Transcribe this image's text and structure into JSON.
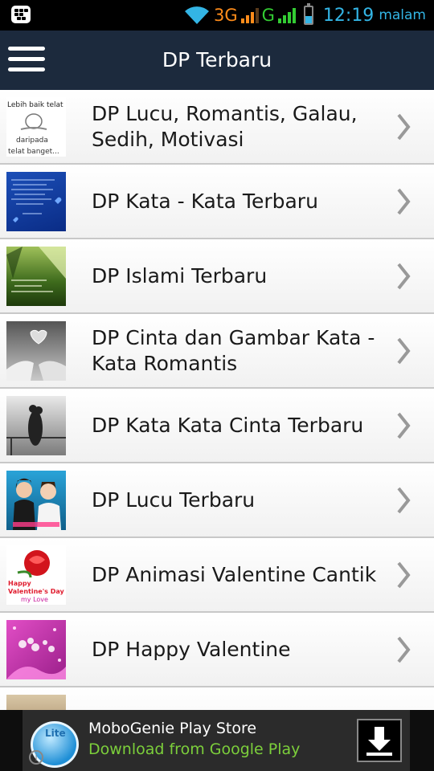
{
  "status_bar": {
    "network_3g": "3G",
    "network_g": "G",
    "time": "12:19",
    "period": "malam",
    "battery_level": 0.45
  },
  "action_bar": {
    "title": "DP Terbaru",
    "menu_icon": "hamburger-menu-icon"
  },
  "list": {
    "chevron_icon": "chevron-right-icon",
    "items": [
      {
        "label": "DP Lucu, Romantis, Galau, Sedih, Motivasi",
        "thumb_text": [
          "Lebih baik telat",
          "daripada",
          "telat banget..."
        ]
      },
      {
        "label": "DP Kata - Kata Terbaru"
      },
      {
        "label": "DP Islami Terbaru"
      },
      {
        "label": "DP Cinta dan Gambar Kata - Kata Romantis"
      },
      {
        "label": "DP Kata Kata Cinta Terbaru"
      },
      {
        "label": "DP Lucu Terbaru"
      },
      {
        "label": "DP Animasi Valentine Cantik",
        "thumb_text": [
          "Happy",
          "Valentine's Day",
          "my Love"
        ]
      },
      {
        "label": "DP Happy Valentine"
      }
    ]
  },
  "ad": {
    "title": "MoboGenie Play Store",
    "subtitle": "Download from Google Play",
    "logo_text": "Lite",
    "download_icon": "download-arrow-icon",
    "info_icon": "info-icon"
  },
  "colors": {
    "action_bar": "#1c2a3d",
    "status_accent": "#33b5e5",
    "ad_subtitle": "#7ccf3b"
  }
}
